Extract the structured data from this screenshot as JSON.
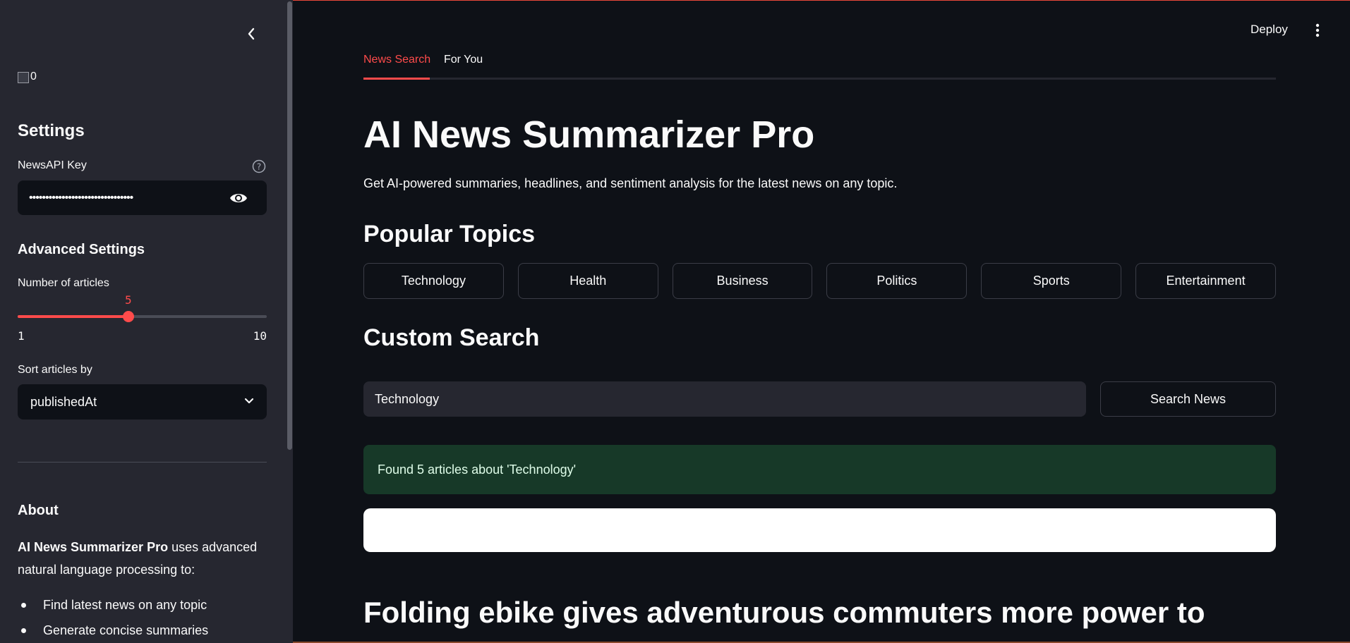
{
  "sidebar": {
    "broken_image_alt": "0",
    "settings_title": "Settings",
    "api_key_label": "NewsAPI Key",
    "api_key_value": "••••••••••••••••••••••••••••••••",
    "advanced_title": "Advanced Settings",
    "num_articles_label": "Number of articles",
    "slider": {
      "value": 5,
      "min": 1,
      "max": 10,
      "value_text": "5",
      "min_text": "1",
      "max_text": "10"
    },
    "sort_label": "Sort articles by",
    "sort_value": "publishedAt",
    "about_title": "About",
    "about_bold": "AI News Summarizer Pro",
    "about_text": " uses advanced natural language processing to:",
    "about_items": [
      "Find latest news on any topic",
      "Generate concise summaries"
    ]
  },
  "header": {
    "deploy_label": "Deploy"
  },
  "tabs": [
    {
      "label": "News Search",
      "active": true
    },
    {
      "label": "For You",
      "active": false
    }
  ],
  "main": {
    "title": "AI News Summarizer Pro",
    "subtitle": "Get AI-powered summaries, headlines, and sentiment analysis for the latest news on any topic.",
    "popular_title": "Popular Topics",
    "topics": [
      "Technology",
      "Health",
      "Business",
      "Politics",
      "Sports",
      "Entertainment"
    ],
    "custom_title": "Custom Search",
    "search_value": "Technology",
    "search_button": "Search News",
    "success_message": "Found 5 articles about 'Technology'",
    "headline": "Folding ebike gives adventurous commuters more power to"
  },
  "colors": {
    "accent": "#ff4b4b",
    "background": "#0e1117",
    "sidebar": "#262730",
    "success_bg": "#173928"
  }
}
